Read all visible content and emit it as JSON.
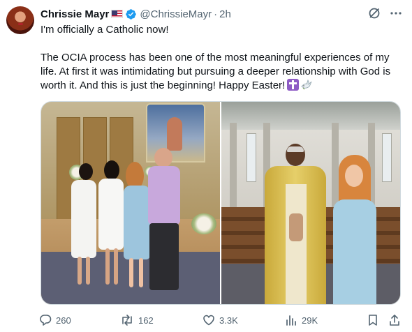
{
  "author": {
    "name": "Chrissie Mayr",
    "handle": "@ChrissieMayr",
    "separator": "·",
    "time": "2h"
  },
  "tweet": {
    "line1": "I'm officially a Catholic now!",
    "line2": "The OCIA process has been one of the most meaningful experiences of my life. At first it was intimidating but pursuing a deeper relationship with God is worth it. And this is just the beginning! Happy Easter!",
    "emoji": [
      "latin-cross-emoji",
      "dove-emoji"
    ]
  },
  "media": {
    "photos": [
      {
        "description_icon": "photo-group-of-four-icon"
      },
      {
        "description_icon": "photo-priest-and-woman-icon"
      }
    ]
  },
  "stats": {
    "replies": "260",
    "reposts": "162",
    "likes": "3.3K",
    "views": "29K"
  },
  "icons": {
    "verified": "verified-badge-icon",
    "flag": "us-flag-icon",
    "grok": "grok-icon",
    "more": "more-icon",
    "reply": "reply-icon",
    "repost": "repost-icon",
    "like": "like-icon",
    "views": "views-icon",
    "bookmark": "bookmark-icon",
    "share": "share-icon"
  },
  "colors": {
    "verified_blue": "#1d9bf0",
    "secondary_text": "#536471",
    "primary_text": "#0f1419"
  }
}
